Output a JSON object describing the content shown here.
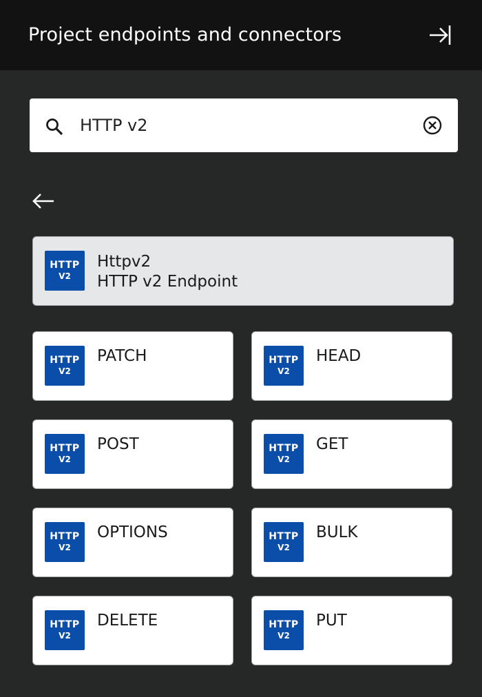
{
  "header": {
    "title": "Project endpoints and connectors",
    "collapse_icon": "collapse-panel-icon"
  },
  "search": {
    "value": "HTTP v2",
    "placeholder": "",
    "search_icon": "search-icon",
    "clear_icon": "clear-circle-icon"
  },
  "nav": {
    "back_icon": "arrow-left-icon"
  },
  "logo": {
    "line1": "HTTP",
    "line2": "V2"
  },
  "featured": {
    "name": "Httpv2",
    "subtitle": "HTTP v2 Endpoint"
  },
  "methods": [
    {
      "label": "PATCH"
    },
    {
      "label": "HEAD"
    },
    {
      "label": "POST"
    },
    {
      "label": "GET"
    },
    {
      "label": "OPTIONS"
    },
    {
      "label": "BULK"
    },
    {
      "label": "DELETE"
    },
    {
      "label": "PUT"
    }
  ],
  "colors": {
    "background": "#262828",
    "header": "#121212",
    "logo": "#0b4eaa",
    "featured_card": "#e6e7e9",
    "card": "#ffffff"
  }
}
